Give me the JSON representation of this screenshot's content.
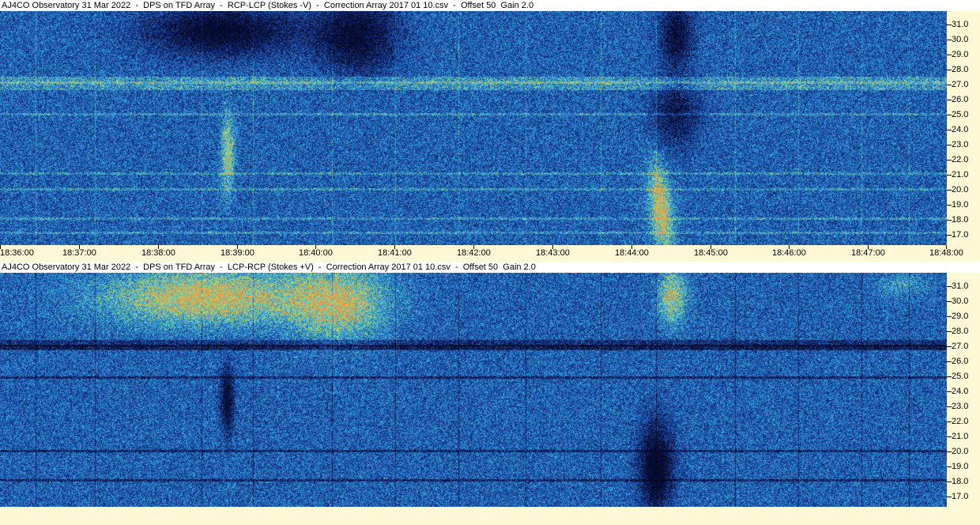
{
  "panels": [
    {
      "title": "AJ4CO Observatory 31 Mar 2022  -  DPS on TFD Array  -  RCP-LCP (Stokes -V)  -  Correction Array 2017 01 10.csv  -  Offset 50  Gain 2.0",
      "polarity": "RCP-LCP"
    },
    {
      "title": "AJ4CO Observatory 31 Mar 2022  -  DPS on TFD Array  -  LCP-RCP (Stokes +V)  -  Correction Array 2017 01 10.csv  -  Offset 50  Gain 2.0",
      "polarity": "LCP-RCP"
    }
  ],
  "y_ticks": [
    "31.0",
    "30.0",
    "29.0",
    "28.0",
    "27.0",
    "26.0",
    "25.0",
    "24.0",
    "23.0",
    "22.0",
    "21.0",
    "20.0",
    "19.0",
    "18.0",
    "17.0"
  ],
  "x_ticks": [
    "18:36:00",
    "18:37:00",
    "18:38:00",
    "18:39:00",
    "18:40:00",
    "18:41:00",
    "18:42:00",
    "18:43:00",
    "18:44:00",
    "18:45:00",
    "18:46:00",
    "18:47:00",
    "18:48:00"
  ],
  "colors": {
    "background_axis": "#fff8d6",
    "spectrogram_base": "#1f4d9e"
  }
}
